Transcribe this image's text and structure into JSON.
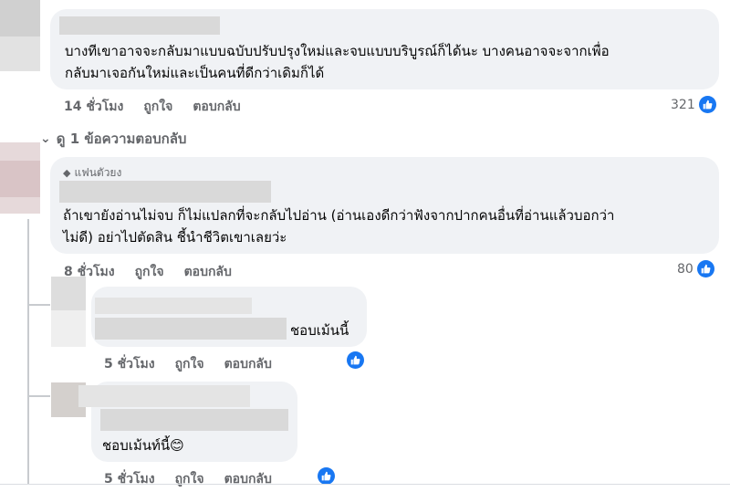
{
  "comments": [
    {
      "text_line1": "บางทีเขาอาจจะกลับมาแบบฉบับปรับปรุงใหม่และจบแบบบริบูรณ์ก็ได้นะ บางคนอาจจะจากเพื่อ",
      "text_line2": "กลับมาเจอกันใหม่และเป็นคนที่ดีกว่าเดิมก็ได้",
      "time": "14 ชั่วโมง",
      "like": "ถูกใจ",
      "reply": "ตอบกลับ",
      "like_count": "321"
    },
    {
      "badge": "แฟนตัวยง",
      "text_line1": "ถ้าเขายังอ่านไม่จบ ก็ไม่แปลกที่จะกลับไปอ่าน (อ่านเองดีกว่าฟังจากปากคนอื่นที่อ่านแล้วบอกว่า",
      "text_line2": "ไม่ดี) อย่าไปตัดสิน ชี้นำชีวิตเขาเลยว่ะ",
      "time": "8 ชั่วโมง",
      "like": "ถูกใจ",
      "reply": "ตอบกลับ",
      "like_count": "80"
    },
    {
      "text": "ชอบเม้นนี้",
      "time": "5 ชั่วโมง",
      "like": "ถูกใจ",
      "reply": "ตอบกลับ"
    },
    {
      "text": "ชอบเม้นท์นี้",
      "emoji": "😊",
      "time": "5 ชั่วโมง",
      "like": "ถูกใจ",
      "reply": "ตอบกลับ"
    }
  ],
  "view_replies": "ดู 1 ข้อความตอบกลับ",
  "colors": {
    "like_blue": "#1877f2",
    "bubble": "#f0f2f5",
    "meta": "#65676b"
  },
  "icons": {
    "like": "thumbs-up-icon",
    "reply_arrow": "reply-arrow-icon",
    "badge": "diamond-icon"
  }
}
